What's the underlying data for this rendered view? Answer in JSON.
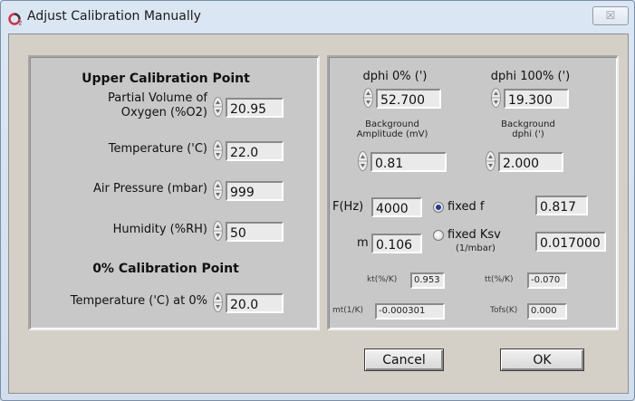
{
  "window": {
    "title": "Adjust Calibration Manually",
    "close_label": "☒",
    "app_icon": "o2-logo-icon"
  },
  "left": {
    "upper_heading": "Upper Calibration Point",
    "partial_volume": {
      "label_line1": "Partial Volume of",
      "label_line2": "Oxygen (%O2)",
      "value": "20.95"
    },
    "temperature": {
      "label": "Temperature ('C)",
      "value": "22.0"
    },
    "air_pressure": {
      "label": "Air Pressure (mbar)",
      "value": "999"
    },
    "humidity": {
      "label": "Humidity (%RH)",
      "value": "50"
    },
    "zero_heading": "0% Calibration Point",
    "zero_temperature": {
      "label": "Temperature ('C) at 0%",
      "value": "20.0"
    }
  },
  "right": {
    "dphi0": {
      "label": "dphi 0% (')",
      "value": "52.700"
    },
    "dphi100": {
      "label": "dphi 100% (')",
      "value": "19.300"
    },
    "bg_amp": {
      "label_line1": "Background",
      "label_line2": "Amplitude (mV)",
      "value": "0.81"
    },
    "bg_dphi": {
      "label_line1": "Background",
      "label_line2": "dphi (')",
      "value": "2.000"
    },
    "fhz": {
      "label": "F(Hz)",
      "value": "4000"
    },
    "fixed_f": {
      "label": "fixed f",
      "value": "0.817",
      "selected": true
    },
    "m": {
      "label": "m",
      "value": "0.106"
    },
    "fixed_ksv": {
      "label": "fixed Ksv",
      "sublabel": "(1/mbar)",
      "value": "0.017000",
      "selected": false
    },
    "kt": {
      "label": "kt(%/K)",
      "value": "0.953"
    },
    "tt": {
      "label": "tt(%/K)",
      "value": "-0.070"
    },
    "mt": {
      "label": "mt(1/K)",
      "value": "-0.000301"
    },
    "tofs": {
      "label": "Tofs(K)",
      "value": "0.000"
    }
  },
  "buttons": {
    "cancel": "Cancel",
    "ok": "OK"
  }
}
